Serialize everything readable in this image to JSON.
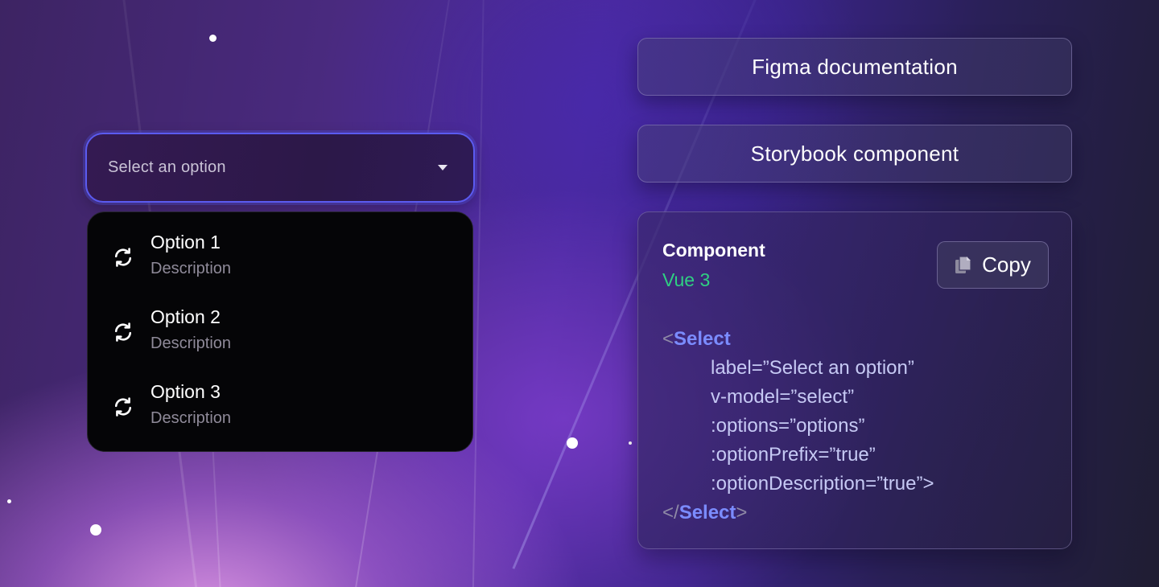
{
  "select": {
    "placeholder": "Select an option",
    "caret_icon": "caret-down-icon"
  },
  "dropdown": {
    "options": [
      {
        "label": "Option 1",
        "description": "Description",
        "icon": "sync-icon"
      },
      {
        "label": "Option 2",
        "description": "Description",
        "icon": "sync-icon"
      },
      {
        "label": "Option 3",
        "description": "Description",
        "icon": "sync-icon"
      }
    ]
  },
  "links": {
    "figma": "Figma documentation",
    "storybook": "Storybook component"
  },
  "code_card": {
    "title": "Component",
    "framework": "Vue 3",
    "copy_label": "Copy",
    "copy_icon": "copy-icon",
    "code": {
      "open_bracket": "<",
      "tag_name": "Select",
      "attr_lines": [
        "label=”Select an option”",
        "v-model=”select”",
        ":options=”options”",
        ":optionPrefix=”true”",
        ":optionDescription=”true”"
      ],
      "attr_close": ">",
      "close_open_bracket": "</",
      "close_tag_name": "Select",
      "close_bracket": ">"
    }
  },
  "colors": {
    "accent": "#5b5bf0",
    "framework_green": "#2fd082",
    "code_tag": "#7b8cff",
    "dropdown_bg": "#050507"
  }
}
